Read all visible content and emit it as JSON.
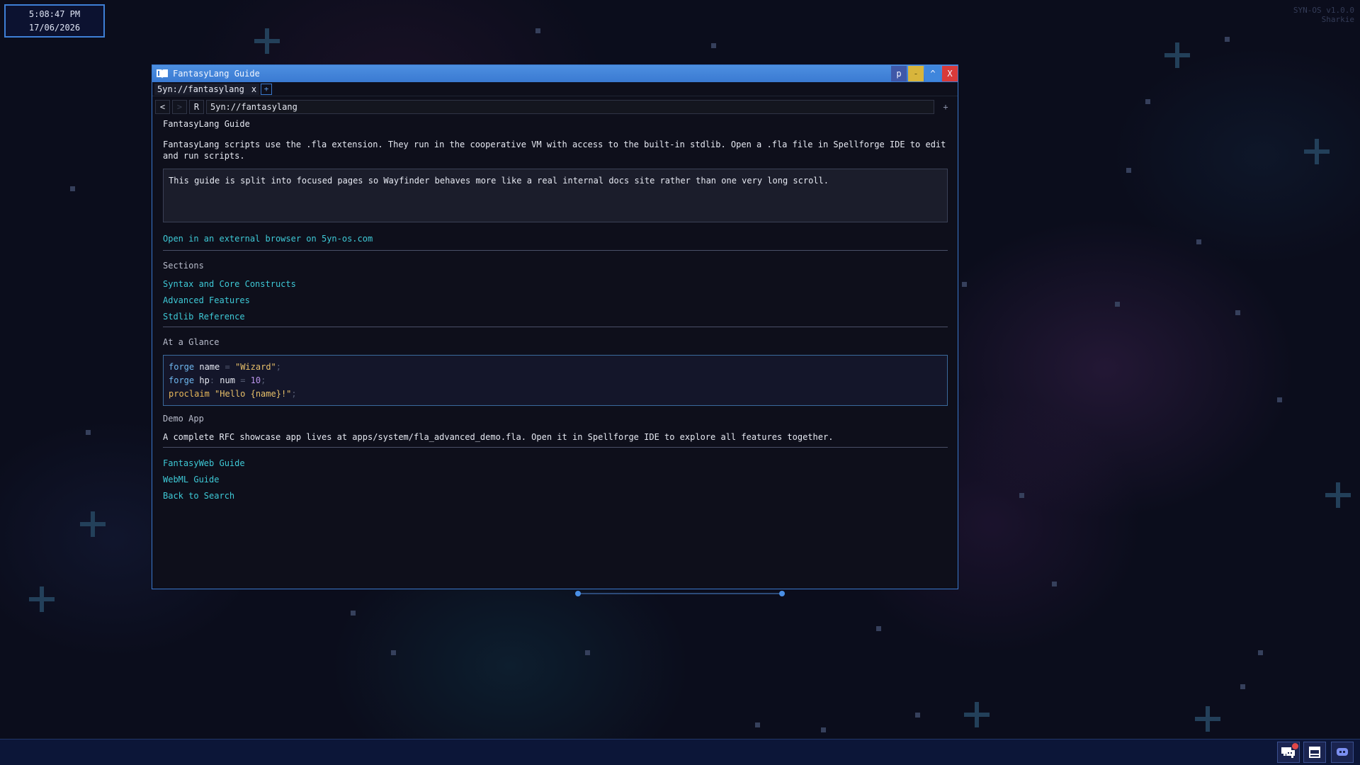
{
  "desktop": {
    "clock_time": "5:08:47 PM",
    "clock_date": "17/06/2026",
    "version": "SYN-OS v1.0.0",
    "user": "Sharkie"
  },
  "window": {
    "title": "FantasyLang Guide",
    "buttons": {
      "p": "p",
      "minimize": "-",
      "maximize": "^",
      "close": "X"
    },
    "tab_label": "5yn://fantasylang",
    "tab_close": "x",
    "tab_new": "+",
    "nav": {
      "back": "<",
      "forward": ">",
      "reload": "R",
      "add": "+"
    },
    "address": "5yn://fantasylang"
  },
  "page": {
    "title": "FantasyLang Guide",
    "intro": "FantasyLang scripts use the .fla extension. They run in the cooperative VM with access to the built-in stdlib. Open a .fla file in Spellforge IDE to edit and run scripts.",
    "notice": "This guide is split into focused pages so Wayfinder behaves more like a real internal docs site rather than one very long scroll.",
    "external_link": "Open in an external browser on 5yn-os.com",
    "sections_heading": "Sections",
    "sections": [
      "Syntax and Core Constructs",
      "Advanced Features",
      "Stdlib Reference"
    ],
    "glance_heading": "At a Glance",
    "code": {
      "l1_kw": "forge",
      "l1_name": "name",
      "l1_eq": "=",
      "l1_val": "\"Wizard\"",
      "l1_end": ";",
      "l2_kw": "forge",
      "l2_name": "hp",
      "l2_colon": ":",
      "l2_type": "num",
      "l2_eq": "=",
      "l2_val": "10",
      "l2_end": ";",
      "l3_fn": "proclaim",
      "l3_val": "\"Hello {name}!\"",
      "l3_end": ";"
    },
    "demo_heading": "Demo App",
    "demo_text": "A complete RFC showcase app lives at apps/system/fla_advanced_demo.fla. Open it in Spellforge IDE to explore all features together.",
    "footer_links": [
      "FantasyWeb Guide",
      "WebML Guide",
      "Back to Search"
    ]
  },
  "taskbar": {
    "icons": [
      "chat-icon",
      "window-icon",
      "discord-icon"
    ],
    "notification_count": "1"
  }
}
